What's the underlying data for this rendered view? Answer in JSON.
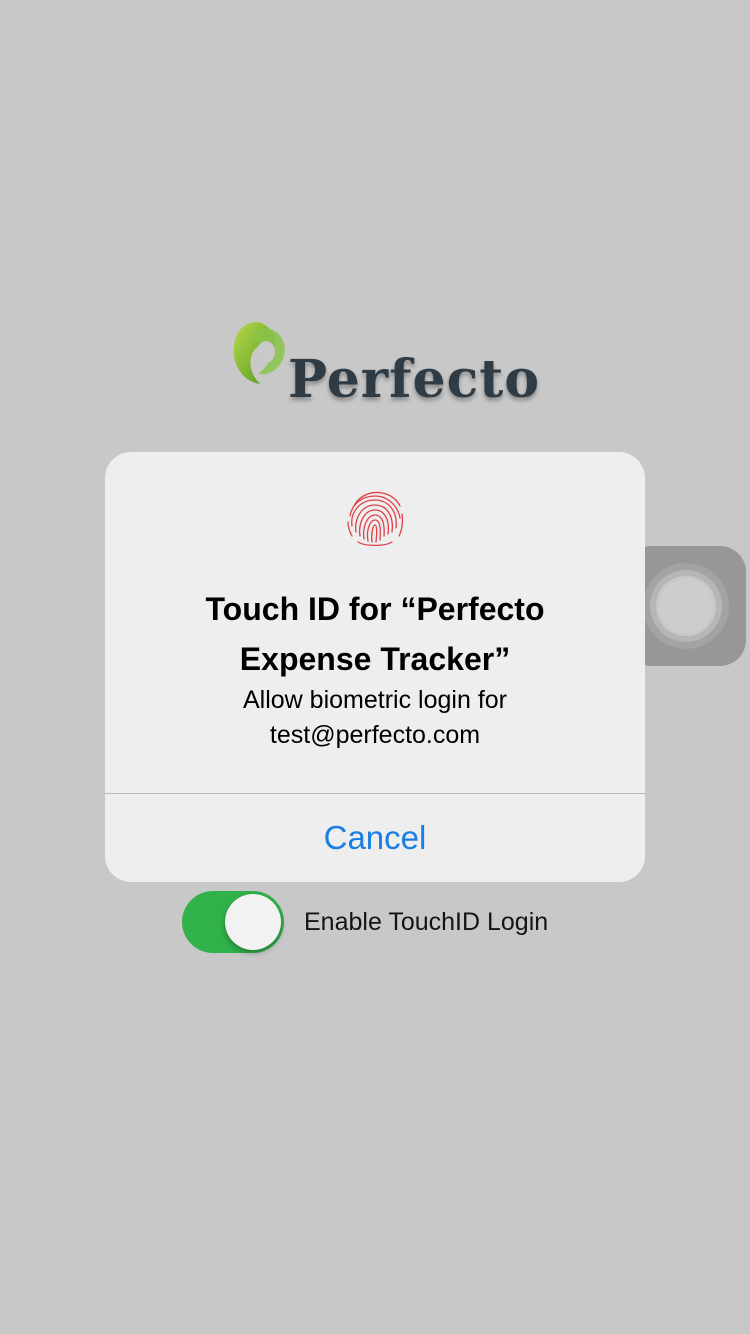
{
  "app": {
    "logo_text": "Perfecto",
    "logo_icon": "perfecto-leaf-logo"
  },
  "alert": {
    "icon": "fingerprint-icon",
    "title": "Touch ID for “Perfecto Expense Tracker”",
    "message": "Allow biometric login for test@perfecto.com",
    "cancel_label": "Cancel"
  },
  "settings": {
    "touchid_toggle_label": "Enable TouchID Login",
    "touchid_enabled": true
  },
  "assistive_touch": {
    "icon": "assistive-touch-icon"
  },
  "colors": {
    "background": "#c8c8c8",
    "toggle_on": "#30b14a",
    "alert_button": "#1a7fe0",
    "fingerprint": "#e0414a",
    "logo_text": "#2f3c46"
  }
}
